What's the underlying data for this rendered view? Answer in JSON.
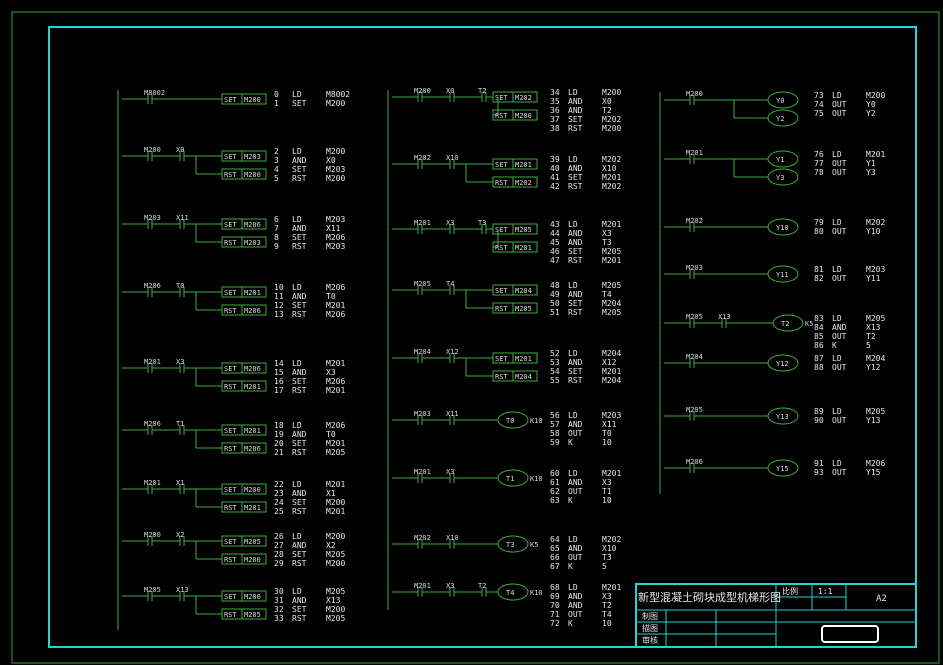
{
  "diagram_title": "新型混凝土砌块成型机梯形图",
  "title_block": {
    "title": "新型混凝土砌块成型机梯形图",
    "scale_label": "比例",
    "scale_value": "1:1",
    "sheet_size": "A2",
    "drawn_label": "制图",
    "drafted_label": "描图",
    "checked_label": "审核"
  },
  "rungs": [
    {
      "contacts": [
        "M8002"
      ],
      "coils": [
        {
          "type": "SET",
          "dev": "M200"
        }
      ],
      "il": [
        [
          "0",
          "LD",
          "M8002"
        ],
        [
          "1",
          "SET",
          "M200"
        ]
      ]
    },
    {
      "contacts": [
        "M200",
        "X0"
      ],
      "coils": [
        {
          "type": "SET",
          "dev": "M203"
        },
        {
          "type": "RST",
          "dev": "M200"
        }
      ],
      "il": [
        [
          "2",
          "LD",
          "M200"
        ],
        [
          "3",
          "AND",
          "X0"
        ],
        [
          "4",
          "SET",
          "M203"
        ],
        [
          "5",
          "RST",
          "M200"
        ]
      ]
    },
    {
      "contacts": [
        "M203",
        "X11"
      ],
      "coils": [
        {
          "type": "SET",
          "dev": "M206"
        },
        {
          "type": "RST",
          "dev": "M203"
        }
      ],
      "il": [
        [
          "6",
          "LD",
          "M203"
        ],
        [
          "7",
          "AND",
          "X11"
        ],
        [
          "8",
          "SET",
          "M206"
        ],
        [
          "9",
          "RST",
          "M203"
        ]
      ]
    },
    {
      "contacts": [
        "M206",
        "T0"
      ],
      "coils": [
        {
          "type": "SET",
          "dev": "M201"
        },
        {
          "type": "RST",
          "dev": "M206"
        }
      ],
      "il": [
        [
          "10",
          "LD",
          "M206"
        ],
        [
          "11",
          "AND",
          "T0"
        ],
        [
          "12",
          "SET",
          "M201"
        ],
        [
          "13",
          "RST",
          "M206"
        ]
      ]
    },
    {
      "contacts": [
        "M201",
        "X3"
      ],
      "coils": [
        {
          "type": "SET",
          "dev": "M206"
        },
        {
          "type": "RST",
          "dev": "M201"
        }
      ],
      "il": [
        [
          "14",
          "LD",
          "M201"
        ],
        [
          "15",
          "AND",
          "X3"
        ],
        [
          "16",
          "SET",
          "M206"
        ],
        [
          "17",
          "RST",
          "M201"
        ]
      ]
    },
    {
      "contacts": [
        "M206",
        "T1"
      ],
      "coils": [
        {
          "type": "SET",
          "dev": "M201"
        },
        {
          "type": "RST",
          "dev": "M206"
        }
      ],
      "il": [
        [
          "18",
          "LD",
          "M206"
        ],
        [
          "19",
          "AND",
          "T0"
        ],
        [
          "20",
          "SET",
          "M201"
        ],
        [
          "21",
          "RST",
          "M205"
        ]
      ]
    },
    {
      "contacts": [
        "M201",
        "X1"
      ],
      "coils": [
        {
          "type": "SET",
          "dev": "M200"
        },
        {
          "type": "RST",
          "dev": "M201"
        }
      ],
      "il": [
        [
          "22",
          "LD",
          "M201"
        ],
        [
          "23",
          "AND",
          "X1"
        ],
        [
          "24",
          "SET",
          "M200"
        ],
        [
          "25",
          "RST",
          "M201"
        ]
      ]
    },
    {
      "contacts": [
        "M200",
        "X2"
      ],
      "coils": [
        {
          "type": "SET",
          "dev": "M205"
        },
        {
          "type": "RST",
          "dev": "M200"
        }
      ],
      "il": [
        [
          "26",
          "LD",
          "M200"
        ],
        [
          "27",
          "AND",
          "X2"
        ],
        [
          "28",
          "SET",
          "M205"
        ],
        [
          "29",
          "RST",
          "M200"
        ]
      ]
    },
    {
      "contacts": [
        "M205",
        "X13"
      ],
      "coils": [
        {
          "type": "SET",
          "dev": "M200"
        },
        {
          "type": "RST",
          "dev": "M205"
        }
      ],
      "il": [
        [
          "30",
          "LD",
          "M205"
        ],
        [
          "31",
          "AND",
          "X13"
        ],
        [
          "32",
          "SET",
          "M200"
        ],
        [
          "33",
          "RST",
          "M205"
        ]
      ]
    },
    {
      "contacts": [
        "M200",
        "X0",
        "T2"
      ],
      "coils": [
        {
          "type": "SET",
          "dev": "M202"
        },
        {
          "type": "RST",
          "dev": "M200"
        }
      ],
      "il": [
        [
          "34",
          "LD",
          "M200"
        ],
        [
          "35",
          "AND",
          "X0"
        ],
        [
          "36",
          "AND",
          "T2"
        ],
        [
          "37",
          "SET",
          "M202"
        ],
        [
          "38",
          "RST",
          "M200"
        ]
      ]
    },
    {
      "contacts": [
        "M202",
        "X10"
      ],
      "coils": [
        {
          "type": "SET",
          "dev": "M201"
        },
        {
          "type": "RST",
          "dev": "M202"
        }
      ],
      "il": [
        [
          "39",
          "LD",
          "M202"
        ],
        [
          "40",
          "AND",
          "X10"
        ],
        [
          "41",
          "SET",
          "M201"
        ],
        [
          "42",
          "RST",
          "M202"
        ]
      ]
    },
    {
      "contacts": [
        "M201",
        "X3",
        "T3"
      ],
      "coils": [
        {
          "type": "SET",
          "dev": "M205"
        },
        {
          "type": "RST",
          "dev": "M201"
        }
      ],
      "il": [
        [
          "43",
          "LD",
          "M201"
        ],
        [
          "44",
          "AND",
          "X3"
        ],
        [
          "45",
          "AND",
          "T3"
        ],
        [
          "46",
          "SET",
          "M205"
        ],
        [
          "47",
          "RST",
          "M201"
        ]
      ]
    },
    {
      "contacts": [
        "M205",
        "T4"
      ],
      "coils": [
        {
          "type": "SET",
          "dev": "M204"
        },
        {
          "type": "RST",
          "dev": "M205"
        }
      ],
      "il": [
        [
          "48",
          "LD",
          "M205"
        ],
        [
          "49",
          "AND",
          "T4"
        ],
        [
          "50",
          "SET",
          "M204"
        ],
        [
          "51",
          "RST",
          "M205"
        ]
      ]
    },
    {
      "contacts": [
        "M204",
        "X12"
      ],
      "coils": [
        {
          "type": "SET",
          "dev": "M201"
        },
        {
          "type": "RST",
          "dev": "M204"
        }
      ],
      "il": [
        [
          "52",
          "LD",
          "M204"
        ],
        [
          "53",
          "AND",
          "X12"
        ],
        [
          "54",
          "SET",
          "M201"
        ],
        [
          "55",
          "RST",
          "M204"
        ]
      ]
    },
    {
      "contacts": [
        "M203",
        "X11"
      ],
      "coils": [
        {
          "type": "TMR",
          "dev": "T0",
          "k": "K10"
        }
      ],
      "il": [
        [
          "56",
          "LD",
          "M203"
        ],
        [
          "57",
          "AND",
          "X11"
        ],
        [
          "58",
          "OUT",
          "T0"
        ],
        [
          "59",
          "K",
          "10"
        ]
      ]
    },
    {
      "contacts": [
        "M201",
        "X3"
      ],
      "coils": [
        {
          "type": "TMR",
          "dev": "T1",
          "k": "K10"
        }
      ],
      "il": [
        [
          "60",
          "LD",
          "M201"
        ],
        [
          "61",
          "AND",
          "X3"
        ],
        [
          "62",
          "OUT",
          "T1"
        ],
        [
          "63",
          "K",
          "10"
        ]
      ]
    },
    {
      "contacts": [
        "M202",
        "X10"
      ],
      "coils": [
        {
          "type": "TMR",
          "dev": "T3",
          "k": "K5"
        }
      ],
      "il": [
        [
          "64",
          "LD",
          "M202"
        ],
        [
          "65",
          "AND",
          "X10"
        ],
        [
          "66",
          "OUT",
          "T3"
        ],
        [
          "67",
          "K",
          "5"
        ]
      ]
    },
    {
      "contacts": [
        "M201",
        "X3",
        "T2"
      ],
      "coils": [
        {
          "type": "TMR",
          "dev": "T4",
          "k": "K10"
        }
      ],
      "il": [
        [
          "68",
          "LD",
          "M201"
        ],
        [
          "69",
          "AND",
          "X3"
        ],
        [
          "70",
          "AND",
          "T2"
        ],
        [
          "71",
          "OUT",
          "T4"
        ],
        [
          "72",
          "K",
          "10"
        ]
      ]
    },
    {
      "contacts": [
        "M200"
      ],
      "coils": [
        {
          "type": "OUT",
          "dev": "Y0"
        },
        {
          "type": "OUT",
          "dev": "Y2"
        }
      ],
      "il": [
        [
          "73",
          "LD",
          "M200"
        ],
        [
          "74",
          "OUT",
          "Y0"
        ],
        [
          "75",
          "OUT",
          "Y2"
        ]
      ]
    },
    {
      "contacts": [
        "M201"
      ],
      "coils": [
        {
          "type": "OUT",
          "dev": "Y1"
        },
        {
          "type": "OUT",
          "dev": "Y3"
        }
      ],
      "il": [
        [
          "76",
          "LD",
          "M201"
        ],
        [
          "77",
          "OUT",
          "Y1"
        ],
        [
          "78",
          "OUT",
          "Y3"
        ]
      ]
    },
    {
      "contacts": [
        "M202"
      ],
      "coils": [
        {
          "type": "OUT",
          "dev": "Y10"
        }
      ],
      "il": [
        [
          "79",
          "LD",
          "M202"
        ],
        [
          "80",
          "OUT",
          "Y10"
        ]
      ]
    },
    {
      "contacts": [
        "M203"
      ],
      "coils": [
        {
          "type": "OUT",
          "dev": "Y11"
        }
      ],
      "il": [
        [
          "81",
          "LD",
          "M203"
        ],
        [
          "82",
          "OUT",
          "Y11"
        ]
      ]
    },
    {
      "contacts": [
        "M205",
        "X13"
      ],
      "coils": [
        {
          "type": "TMR",
          "dev": "T2",
          "k": "K5"
        }
      ],
      "il": [
        [
          "83",
          "LD",
          "M205"
        ],
        [
          "84",
          "AND",
          "X13"
        ],
        [
          "85",
          "OUT",
          "T2"
        ],
        [
          "86",
          "K",
          "5"
        ]
      ]
    },
    {
      "contacts": [
        "M204"
      ],
      "coils": [
        {
          "type": "OUT",
          "dev": "Y12"
        }
      ],
      "il": [
        [
          "87",
          "LD",
          "M204"
        ],
        [
          "88",
          "OUT",
          "Y12"
        ]
      ]
    },
    {
      "contacts": [
        "M205"
      ],
      "coils": [
        {
          "type": "OUT",
          "dev": "Y13"
        }
      ],
      "il": [
        [
          "89",
          "LD",
          "M205"
        ],
        [
          "90",
          "OUT",
          "Y13"
        ]
      ]
    },
    {
      "contacts": [
        "M206"
      ],
      "coils": [
        {
          "type": "OUT",
          "dev": "Y15"
        }
      ],
      "il": [
        [
          "91",
          "LD",
          "M206"
        ],
        [
          "93",
          "OUT",
          "Y15"
        ]
      ]
    }
  ]
}
